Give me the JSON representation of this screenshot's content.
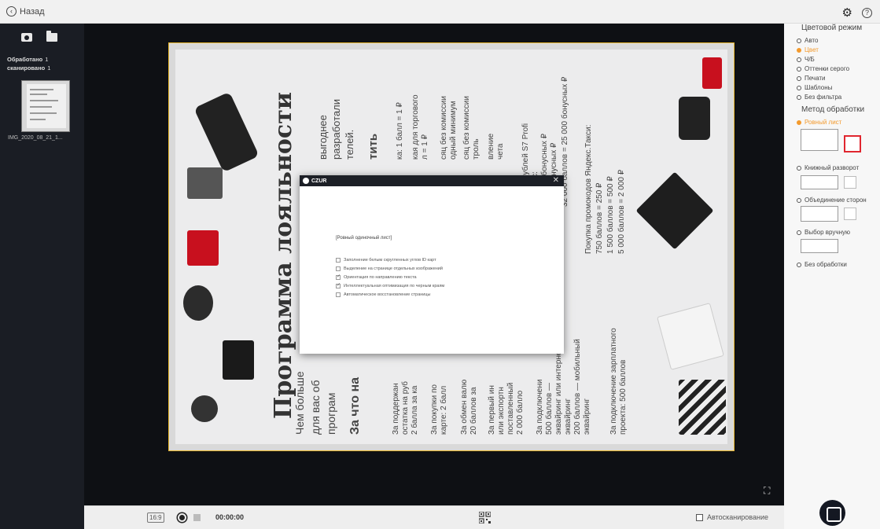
{
  "header": {
    "back_label": "Назад",
    "back_icon": "arrow-left-icon",
    "settings_icon": "gear-icon",
    "help_icon": "question-icon"
  },
  "sidebar": {
    "processed_label": "Обработано",
    "processed_count": "1",
    "scanned_label": "сканировано",
    "scanned_count": "1",
    "thumbnail_name": "IMG_2020_08_21_1..."
  },
  "document": {
    "title": "Программа лояльности",
    "left_col": [
      "Чем больше",
      "для вас об",
      "програм"
    ],
    "subhead": "За что на",
    "blocks": [
      "выгоднее",
      "разработали",
      "телей.",
      "тить",
      "ка: 1 балл = 1 ₽",
      "кая для торгового",
      "л = 1 ₽",
      "сяц без комиссии",
      "одный минимум",
      "сяц без комиссии",
      "троль",
      "вление",
      "чета",
      "ых рублей S7 Profi",
      "илос:",
      "500 бонусных ₽",
      "7 500 бонусных ₽",
      "32 000 баллов = 25 000 бонусных ₽",
      "Покупка промокодов Яндекс.Такси:",
      "750 баллов = 250 ₽",
      "1 500 баллов = 500 ₽",
      "5 000 баллов = 2 000 ₽"
    ],
    "bottom_blocks": [
      "За поддержан",
      "остатка на руб",
      "2 балла за ка",
      "За покупки по",
      "карте: 2 балл",
      "За обмен валю",
      "20 баллов за",
      "За первый ин",
      "или экспортн",
      "поставленный",
      "2 000 балло",
      "За подключени",
      "500 баллов —",
      "эквайринг или интернет",
      "эквайринг",
      "200 баллов — мобильный",
      "эквайринг",
      "За подключение зарплатного",
      "проекта: 500 баллов"
    ]
  },
  "dialog": {
    "brand": "CZUR",
    "close_icon": "close-icon",
    "title": "[Ровный одиночный лист]",
    "options": [
      {
        "label": "Заполнение белым скругленных углов ID карт",
        "checked": false
      },
      {
        "label": "Выделение на странице отдельных изображений",
        "checked": false
      },
      {
        "label": "Ориентация по направлению текста",
        "checked": true
      },
      {
        "label": "Интеллектуальная оптимизация по черным краям",
        "checked": true
      },
      {
        "label": "Автоматическое восстановление страницы",
        "checked": false
      }
    ]
  },
  "bottombar": {
    "ratio_label": "16:9",
    "time": "00:00:00",
    "auto_scan_label": "Автосканирование",
    "auto_scan_checked": false
  },
  "rightpanel": {
    "color_mode_heading": "Цветовой режим",
    "color_modes": [
      {
        "label": "Авто",
        "selected": false
      },
      {
        "label": "Цвет",
        "selected": true
      },
      {
        "label": "Ч/Б",
        "selected": false
      },
      {
        "label": "Оттенки серого",
        "selected": false
      },
      {
        "label": "Печати",
        "selected": false
      },
      {
        "label": "Шаблоны",
        "selected": false
      },
      {
        "label": "Без фильтра",
        "selected": false
      }
    ],
    "method_heading": "Метод обработки",
    "methods": [
      {
        "label": "Ровный лист",
        "selected": true
      },
      {
        "label": "Книжный разворот",
        "selected": false
      },
      {
        "label": "Объединение сторон",
        "selected": false
      },
      {
        "label": "Выбор вручную",
        "selected": false
      },
      {
        "label": "Без обработки",
        "selected": false
      }
    ],
    "accent_color": "#f39a2d",
    "highlight_color": "#e0262f"
  }
}
